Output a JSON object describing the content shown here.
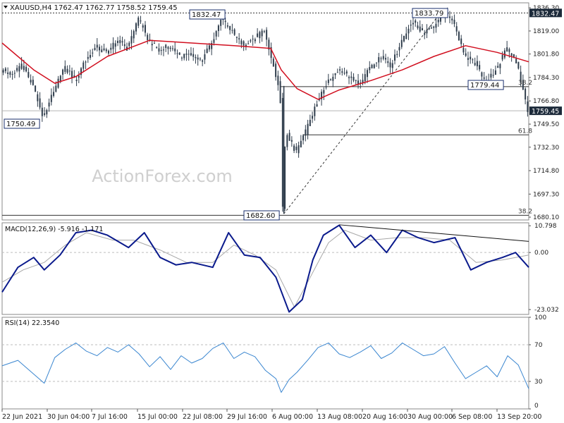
{
  "chart_data": [
    {
      "type": "candlestick",
      "panel": "price",
      "header": "XAUUSD,H4  1762.47 1762.77 1758.52 1759.45",
      "ylim": [
        1678,
        1840
      ],
      "y_ticks": [
        "1836.30",
        "1819.00",
        "1801.80",
        "1784.30",
        "1766.80",
        "1749.50",
        "1732.30",
        "1714.80",
        "1697.30",
        "1680.10"
      ],
      "y_tick_values": [
        1836.3,
        1819.0,
        1801.8,
        1784.3,
        1766.8,
        1749.5,
        1732.3,
        1714.8,
        1697.3,
        1680.1
      ],
      "watermark": "ActionForex.com",
      "last_price": "1759.45",
      "close_path": [
        {
          "t": 0,
          "v": 1790
        },
        {
          "t": 0.02,
          "v": 1787
        },
        {
          "t": 0.04,
          "v": 1793
        },
        {
          "t": 0.06,
          "v": 1778
        },
        {
          "t": 0.08,
          "v": 1755
        },
        {
          "t": 0.1,
          "v": 1774
        },
        {
          "t": 0.12,
          "v": 1793
        },
        {
          "t": 0.14,
          "v": 1782
        },
        {
          "t": 0.16,
          "v": 1796
        },
        {
          "t": 0.18,
          "v": 1808
        },
        {
          "t": 0.2,
          "v": 1803
        },
        {
          "t": 0.22,
          "v": 1812
        },
        {
          "t": 0.24,
          "v": 1806
        },
        {
          "t": 0.26,
          "v": 1828
        },
        {
          "t": 0.27,
          "v": 1822
        },
        {
          "t": 0.28,
          "v": 1812
        },
        {
          "t": 0.3,
          "v": 1805
        },
        {
          "t": 0.32,
          "v": 1808
        },
        {
          "t": 0.34,
          "v": 1800
        },
        {
          "t": 0.36,
          "v": 1803
        },
        {
          "t": 0.38,
          "v": 1796
        },
        {
          "t": 0.4,
          "v": 1810
        },
        {
          "t": 0.42,
          "v": 1828
        },
        {
          "t": 0.44,
          "v": 1818
        },
        {
          "t": 0.46,
          "v": 1808
        },
        {
          "t": 0.48,
          "v": 1813
        },
        {
          "t": 0.5,
          "v": 1820
        },
        {
          "t": 0.51,
          "v": 1803
        },
        {
          "t": 0.53,
          "v": 1775
        },
        {
          "t": 0.535,
          "v": 1684
        },
        {
          "t": 0.54,
          "v": 1745
        },
        {
          "t": 0.56,
          "v": 1728
        },
        {
          "t": 0.58,
          "v": 1745
        },
        {
          "t": 0.6,
          "v": 1766
        },
        {
          "t": 0.62,
          "v": 1781
        },
        {
          "t": 0.64,
          "v": 1789
        },
        {
          "t": 0.66,
          "v": 1786
        },
        {
          "t": 0.68,
          "v": 1778
        },
        {
          "t": 0.7,
          "v": 1791
        },
        {
          "t": 0.72,
          "v": 1800
        },
        {
          "t": 0.74,
          "v": 1793
        },
        {
          "t": 0.76,
          "v": 1810
        },
        {
          "t": 0.78,
          "v": 1826
        },
        {
          "t": 0.8,
          "v": 1818
        },
        {
          "t": 0.82,
          "v": 1822
        },
        {
          "t": 0.84,
          "v": 1832
        },
        {
          "t": 0.86,
          "v": 1825
        },
        {
          "t": 0.88,
          "v": 1800
        },
        {
          "t": 0.9,
          "v": 1795
        },
        {
          "t": 0.92,
          "v": 1780
        },
        {
          "t": 0.94,
          "v": 1790
        },
        {
          "t": 0.96,
          "v": 1806
        },
        {
          "t": 0.98,
          "v": 1795
        },
        {
          "t": 1.0,
          "v": 1759
        }
      ],
      "ema_path": [
        {
          "t": 0,
          "v": 1810
        },
        {
          "t": 0.06,
          "v": 1790
        },
        {
          "t": 0.1,
          "v": 1780
        },
        {
          "t": 0.14,
          "v": 1785
        },
        {
          "t": 0.2,
          "v": 1800
        },
        {
          "t": 0.28,
          "v": 1812
        },
        {
          "t": 0.36,
          "v": 1810
        },
        {
          "t": 0.44,
          "v": 1808
        },
        {
          "t": 0.51,
          "v": 1806
        },
        {
          "t": 0.53,
          "v": 1790
        },
        {
          "t": 0.56,
          "v": 1776
        },
        {
          "t": 0.6,
          "v": 1768
        },
        {
          "t": 0.64,
          "v": 1775
        },
        {
          "t": 0.7,
          "v": 1782
        },
        {
          "t": 0.76,
          "v": 1790
        },
        {
          "t": 0.82,
          "v": 1800
        },
        {
          "t": 0.88,
          "v": 1808
        },
        {
          "t": 0.94,
          "v": 1803
        },
        {
          "t": 1.0,
          "v": 1796
        }
      ],
      "annotations": [
        {
          "text": "1832.47",
          "t": 0.36,
          "v": 1832.47
        },
        {
          "text": "1833.79",
          "t": 0.81,
          "v": 1833.79
        },
        {
          "text": "1750.49",
          "t": 0.035,
          "v": 1750.49
        },
        {
          "text": "1682.60",
          "t": 0.49,
          "v": 1682.6
        },
        {
          "text": "1779.44",
          "t": 0.9,
          "v": 1779.44
        }
      ],
      "fib_labels": [
        {
          "text": "38.2",
          "v": 1777.5
        },
        {
          "text": "61.8",
          "v": 1741.5
        },
        {
          "text": "38.2",
          "v": 1681.5
        }
      ],
      "price_tags": [
        {
          "text": "1832.47",
          "v": 1832.47
        },
        {
          "text": "1759.45",
          "v": 1759.45
        }
      ]
    },
    {
      "type": "line",
      "panel": "macd",
      "header": "MACD(12,26,9) -5.916 -1.171",
      "ylim": [
        -25,
        12
      ],
      "y_ticks": [
        "10.798",
        "0.00",
        "-23.032"
      ],
      "y_tick_values": [
        10.798,
        0.0,
        -23.032
      ],
      "macd_path": [
        {
          "t": 0,
          "v": -16
        },
        {
          "t": 0.03,
          "v": -6
        },
        {
          "t": 0.06,
          "v": -2
        },
        {
          "t": 0.08,
          "v": -7
        },
        {
          "t": 0.11,
          "v": -1
        },
        {
          "t": 0.14,
          "v": 8
        },
        {
          "t": 0.17,
          "v": 9
        },
        {
          "t": 0.2,
          "v": 7
        },
        {
          "t": 0.24,
          "v": 2
        },
        {
          "t": 0.27,
          "v": 8
        },
        {
          "t": 0.3,
          "v": -2
        },
        {
          "t": 0.33,
          "v": -5
        },
        {
          "t": 0.36,
          "v": -4
        },
        {
          "t": 0.4,
          "v": -6
        },
        {
          "t": 0.43,
          "v": 8
        },
        {
          "t": 0.46,
          "v": -1
        },
        {
          "t": 0.49,
          "v": -2
        },
        {
          "t": 0.52,
          "v": -10
        },
        {
          "t": 0.545,
          "v": -24
        },
        {
          "t": 0.57,
          "v": -19
        },
        {
          "t": 0.59,
          "v": -3
        },
        {
          "t": 0.61,
          "v": 7
        },
        {
          "t": 0.64,
          "v": 11
        },
        {
          "t": 0.67,
          "v": 2
        },
        {
          "t": 0.7,
          "v": 7
        },
        {
          "t": 0.73,
          "v": 0
        },
        {
          "t": 0.76,
          "v": 9
        },
        {
          "t": 0.79,
          "v": 6
        },
        {
          "t": 0.82,
          "v": 4
        },
        {
          "t": 0.86,
          "v": 6
        },
        {
          "t": 0.89,
          "v": -7
        },
        {
          "t": 0.92,
          "v": -4
        },
        {
          "t": 0.95,
          "v": -2
        },
        {
          "t": 0.975,
          "v": 0
        },
        {
          "t": 1.0,
          "v": -6
        }
      ],
      "signal_path": [
        {
          "t": 0,
          "v": -12
        },
        {
          "t": 0.04,
          "v": -7
        },
        {
          "t": 0.08,
          "v": -4
        },
        {
          "t": 0.12,
          "v": 3
        },
        {
          "t": 0.16,
          "v": 8
        },
        {
          "t": 0.21,
          "v": 5
        },
        {
          "t": 0.25,
          "v": 5
        },
        {
          "t": 0.3,
          "v": 1
        },
        {
          "t": 0.35,
          "v": -4
        },
        {
          "t": 0.4,
          "v": -4
        },
        {
          "t": 0.44,
          "v": 3
        },
        {
          "t": 0.48,
          "v": -1
        },
        {
          "t": 0.52,
          "v": -7
        },
        {
          "t": 0.555,
          "v": -22
        },
        {
          "t": 0.58,
          "v": -12
        },
        {
          "t": 0.62,
          "v": 4
        },
        {
          "t": 0.65,
          "v": 9
        },
        {
          "t": 0.7,
          "v": 5
        },
        {
          "t": 0.75,
          "v": 6
        },
        {
          "t": 0.8,
          "v": 6
        },
        {
          "t": 0.85,
          "v": 5
        },
        {
          "t": 0.9,
          "v": -4
        },
        {
          "t": 0.95,
          "v": -3
        },
        {
          "t": 1.0,
          "v": -1
        }
      ]
    },
    {
      "type": "line",
      "panel": "rsi",
      "header": "RSI(14) 22.3540",
      "ylim": [
        0,
        100
      ],
      "y_ticks": [
        "100",
        "70",
        "30",
        "0"
      ],
      "y_tick_values": [
        100,
        70,
        30,
        0
      ],
      "rsi_path": [
        {
          "t": 0,
          "v": 47
        },
        {
          "t": 0.03,
          "v": 53
        },
        {
          "t": 0.06,
          "v": 38
        },
        {
          "t": 0.08,
          "v": 28
        },
        {
          "t": 0.1,
          "v": 56
        },
        {
          "t": 0.12,
          "v": 65
        },
        {
          "t": 0.14,
          "v": 72
        },
        {
          "t": 0.16,
          "v": 63
        },
        {
          "t": 0.18,
          "v": 58
        },
        {
          "t": 0.2,
          "v": 67
        },
        {
          "t": 0.22,
          "v": 62
        },
        {
          "t": 0.24,
          "v": 70
        },
        {
          "t": 0.26,
          "v": 60
        },
        {
          "t": 0.28,
          "v": 46
        },
        {
          "t": 0.3,
          "v": 57
        },
        {
          "t": 0.32,
          "v": 43
        },
        {
          "t": 0.34,
          "v": 58
        },
        {
          "t": 0.36,
          "v": 50
        },
        {
          "t": 0.38,
          "v": 55
        },
        {
          "t": 0.4,
          "v": 66
        },
        {
          "t": 0.42,
          "v": 72
        },
        {
          "t": 0.44,
          "v": 55
        },
        {
          "t": 0.46,
          "v": 62
        },
        {
          "t": 0.48,
          "v": 57
        },
        {
          "t": 0.5,
          "v": 42
        },
        {
          "t": 0.52,
          "v": 33
        },
        {
          "t": 0.53,
          "v": 18
        },
        {
          "t": 0.545,
          "v": 32
        },
        {
          "t": 0.56,
          "v": 40
        },
        {
          "t": 0.58,
          "v": 53
        },
        {
          "t": 0.6,
          "v": 67
        },
        {
          "t": 0.62,
          "v": 72
        },
        {
          "t": 0.64,
          "v": 60
        },
        {
          "t": 0.66,
          "v": 56
        },
        {
          "t": 0.68,
          "v": 62
        },
        {
          "t": 0.7,
          "v": 69
        },
        {
          "t": 0.72,
          "v": 55
        },
        {
          "t": 0.74,
          "v": 61
        },
        {
          "t": 0.76,
          "v": 72
        },
        {
          "t": 0.78,
          "v": 65
        },
        {
          "t": 0.8,
          "v": 58
        },
        {
          "t": 0.82,
          "v": 60
        },
        {
          "t": 0.84,
          "v": 68
        },
        {
          "t": 0.86,
          "v": 50
        },
        {
          "t": 0.88,
          "v": 33
        },
        {
          "t": 0.9,
          "v": 40
        },
        {
          "t": 0.92,
          "v": 47
        },
        {
          "t": 0.94,
          "v": 35
        },
        {
          "t": 0.96,
          "v": 58
        },
        {
          "t": 0.98,
          "v": 48
        },
        {
          "t": 1.0,
          "v": 22
        }
      ]
    }
  ],
  "x_axis": {
    "labels": [
      "22 Jun 2021",
      "30 Jun 04:00",
      "7 Jul 16:00",
      "15 Jul 00:00",
      "22 Jul 08:00",
      "29 Jul 16:00",
      "6 Aug 00:00",
      "13 Aug 08:00",
      "20 Aug 16:00",
      "30 Aug 00:00",
      "6 Sep 08:00",
      "13 Sep 20:00"
    ]
  },
  "colors": {
    "candle": "#2f3d4c",
    "ema": "#d10f1f",
    "macd": "#0a1a8c",
    "signal": "#a8a8a8",
    "rsi": "#3a86d0",
    "grid": "#bdbdbd",
    "tag_bg": "#1c2a3a"
  }
}
